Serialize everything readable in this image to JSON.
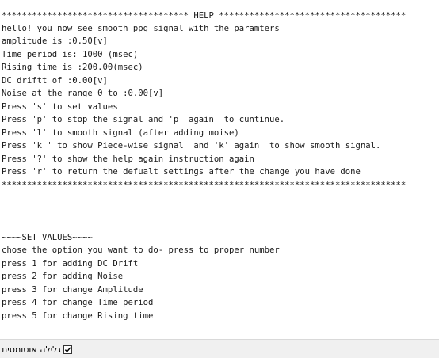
{
  "console": {
    "lines": [
      "************************************* HELP *************************************",
      "hello! you now see smooth ppg signal with the paramters",
      "amplitude is :0.50[v]",
      "Time_period is: 1000 (msec)",
      "Rising time is :200.00(msec)",
      "DC driftt of :0.00[v]",
      "Noise at the range 0 to :0.00[v]",
      "Press 's' to set values",
      "Press 'p' to stop the signal and 'p' again  to cuntinue.",
      "Press 'l' to smooth signal (after adding moise)",
      "Press 'k ' to show Piece-wise signal  and 'k' again  to show smooth signal.",
      "Press '?' to show the help again instruction again",
      "Press 'r' to return the defualt settings after the change you have done",
      "********************************************************************************",
      "",
      "",
      "",
      "~~~~SET VALUES~~~~",
      "chose the option you want to do- press to proper number",
      "press 1 for adding DC Drift",
      "press 2 for adding Noise",
      "press 3 for change Amplitude",
      "press 4 for change Time period",
      "press 5 for change Rising time"
    ]
  },
  "status_bar": {
    "autoscroll_label": "גלילה אוטומטית",
    "autoscroll_checked": true
  }
}
